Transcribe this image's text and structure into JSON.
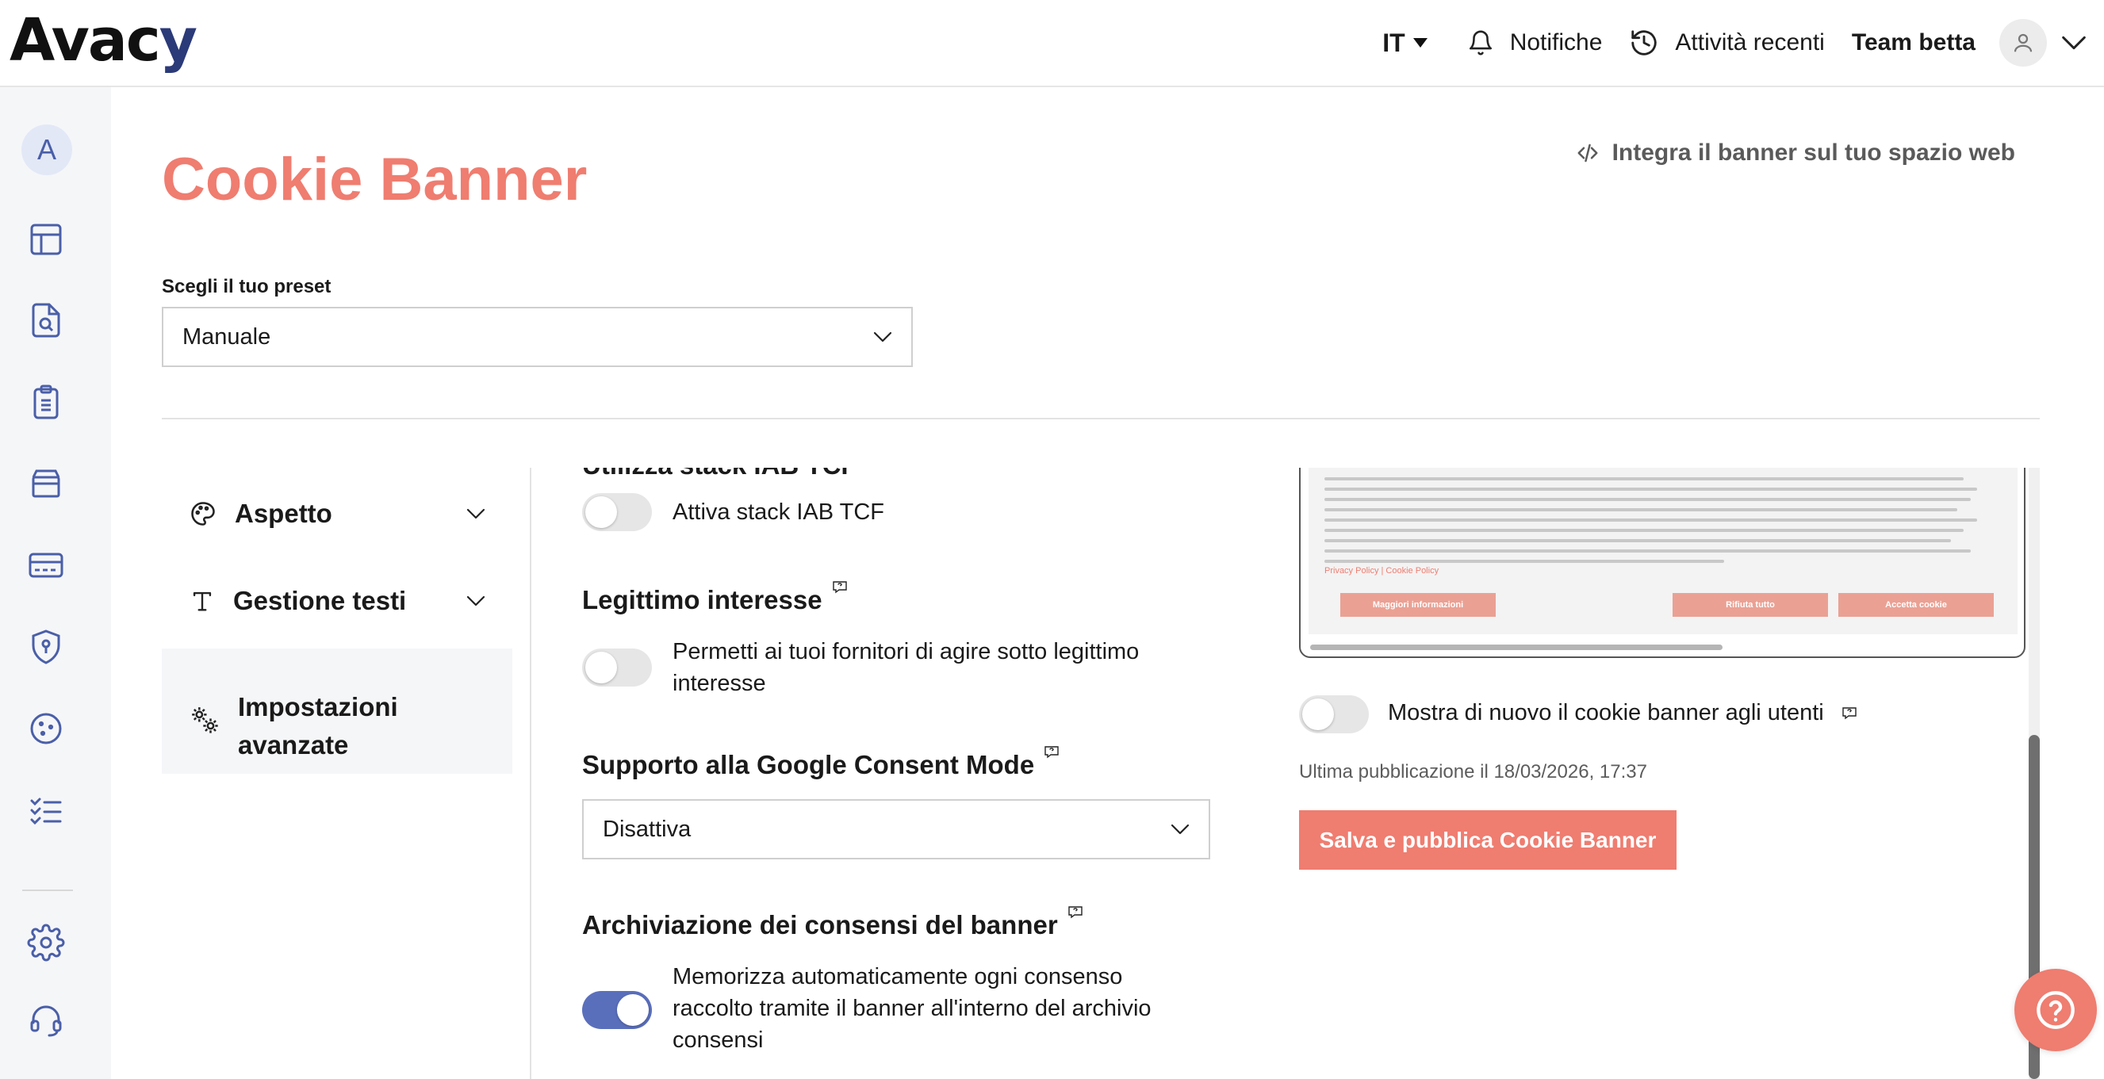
{
  "brand": {
    "logo_text_main": "Ava",
    "logo_text_c": "c",
    "logo_text_y": "y"
  },
  "topbar": {
    "language": "IT",
    "notifications_label": "Notifiche",
    "recent_activity_label": "Attività recenti",
    "team_name": "Team betta"
  },
  "sidebar": {
    "avatar_letter": "A",
    "icons": [
      "dashboard-icon",
      "document-search-icon",
      "clipboard-list-icon",
      "box-icon",
      "banner-icon",
      "shield-key-icon",
      "cookie-icon",
      "checklist-icon",
      "settings-icon",
      "headset-icon"
    ]
  },
  "page": {
    "title": "Cookie Banner",
    "embed_link_label": "Integra il banner sul tuo spazio web",
    "preset_label": "Scegli il tuo preset",
    "preset_value": "Manuale"
  },
  "settings_nav": {
    "items": [
      {
        "label": "Aspetto",
        "icon": "palette-icon"
      },
      {
        "label": "Gestione testi",
        "icon": "text-icon"
      },
      {
        "label": "Impostazioni avanzate",
        "icon": "gears-icon"
      }
    ]
  },
  "settings": {
    "cut_heading": "Utilizza stack IAB TCF",
    "iab_toggle_label": "Attiva stack IAB TCF",
    "legit_interest_heading": "Legittimo interesse",
    "legit_interest_line1": "Permetti ai tuoi fornitori di agire sotto legittimo",
    "legit_interest_line2": "interesse",
    "google_consent_heading": "Supporto alla Google Consent Mode",
    "google_consent_value": "Disattiva",
    "archive_heading": "Archiviazione dei consensi del banner",
    "archive_line1": "Memorizza automaticamente ogni consenso",
    "archive_line2": "raccolto tramite il banner all'interno del archivio",
    "archive_line3": "consensi",
    "toggles": {
      "iab": false,
      "legit_interest": false,
      "archive": true,
      "reshow": false
    }
  },
  "preview": {
    "policy_links": "Privacy Policy  |  Cookie Policy",
    "btn_more": "Maggiori informazioni",
    "btn_reject": "Rifiuta tutto",
    "btn_accept": "Accetta cookie",
    "reshow_label": "Mostra di nuovo il cookie banner agli utenti",
    "last_publish": "Ultima pubblicazione il 18/03/2026, 17:37",
    "publish_button": "Salva e pubblica Cookie Banner"
  },
  "colors": {
    "accent": "#ef7d70",
    "toggle_on": "#5a6fbc",
    "brand_dark": "#2b3a78",
    "sidebar_icon": "#4a5fa8"
  }
}
